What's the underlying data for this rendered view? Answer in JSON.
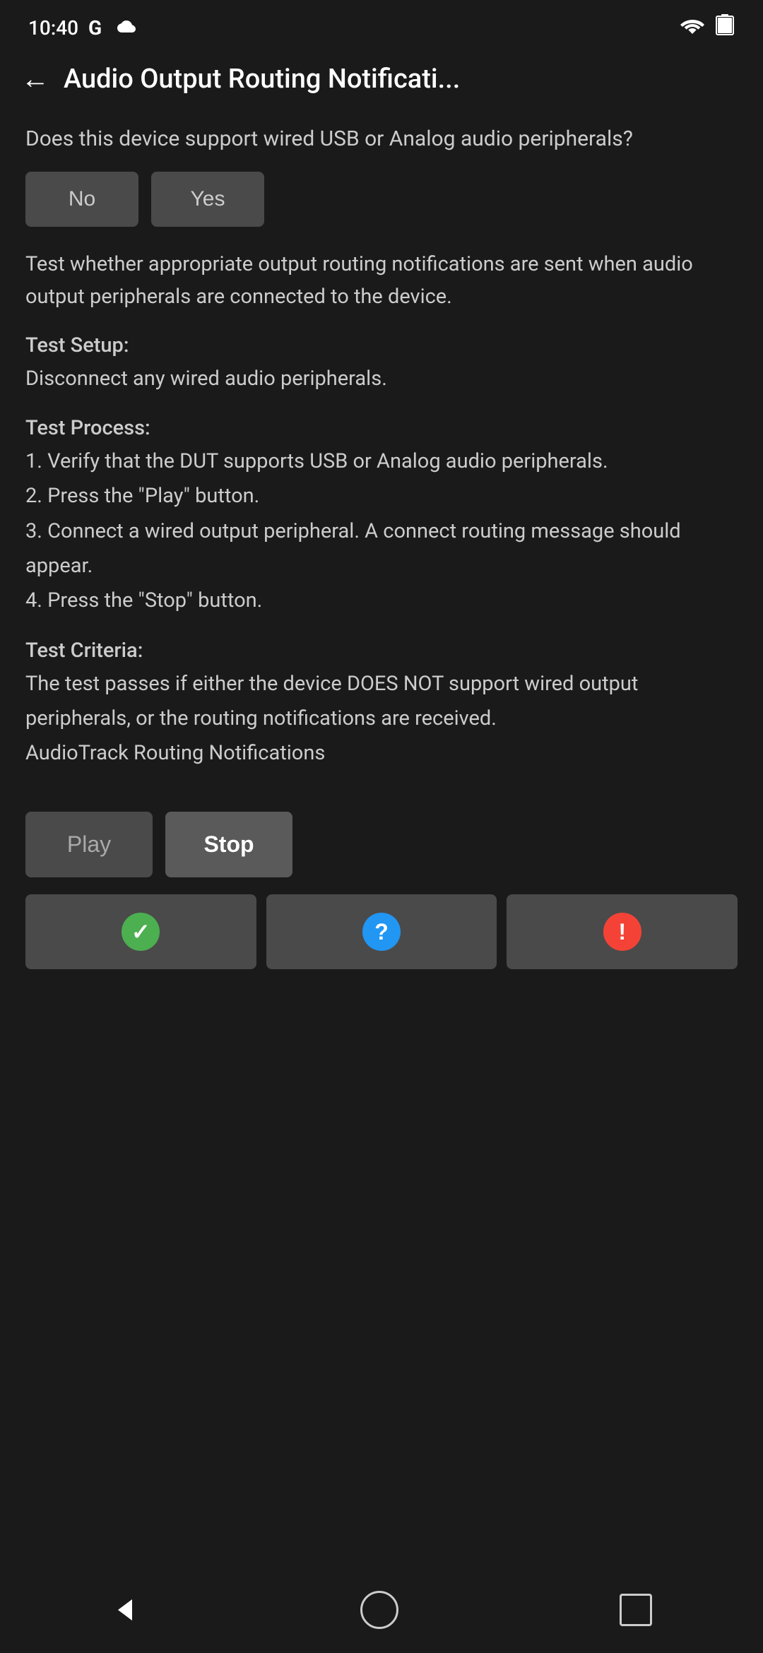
{
  "status_bar": {
    "time": "10:40",
    "google_label": "G",
    "cloud_icon": "cloud",
    "wifi_icon": "wifi",
    "battery_icon": "battery"
  },
  "toolbar": {
    "back_icon": "back-arrow",
    "title": "Audio Output Routing Notificati..."
  },
  "content": {
    "question": "Does this device support wired USB or Analog audio peripherals?",
    "no_button": "No",
    "yes_button": "Yes",
    "description": "Test whether appropriate output routing notifications are sent when audio output peripherals are connected to the device.",
    "test_setup_title": "Test Setup:",
    "test_setup_body": "Disconnect any wired audio peripherals.",
    "test_process_title": "Test Process:",
    "test_process_body": "1. Verify that the DUT supports USB or Analog audio peripherals.\n2. Press the \"Play\" button.\n3. Connect a wired output peripheral. A connect routing message should appear.\n4. Press the \"Stop\" button.",
    "test_criteria_title": "Test Criteria:",
    "test_criteria_body": "The test passes if either the device DOES NOT support wired output peripherals, or the routing notifications are received.\nAudioTrack Routing Notifications",
    "play_button": "Play",
    "stop_button": "Stop",
    "pass_icon": "checkmark",
    "info_icon": "question-mark",
    "fail_icon": "exclamation-mark"
  },
  "nav_bar": {
    "back_icon": "triangle-back",
    "home_icon": "circle-home",
    "recent_icon": "square-recent"
  }
}
